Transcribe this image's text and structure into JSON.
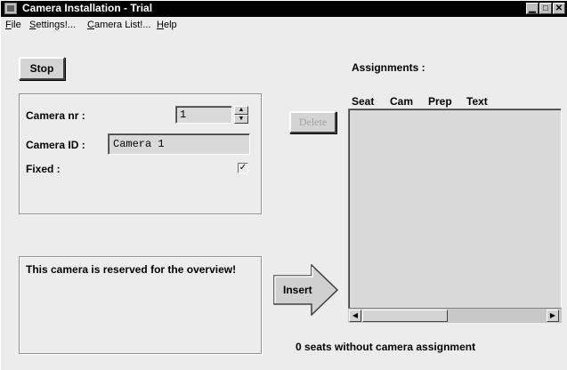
{
  "window": {
    "title": "Camera Installation - Trial",
    "minimize_glyph": "▁",
    "maximize_glyph": "□",
    "close_glyph": "✕"
  },
  "menu": {
    "file": "File",
    "settings": "Settings!...",
    "camera_list": "Camera List!...",
    "help": "Help"
  },
  "stop_label": "Stop",
  "camera": {
    "nr_label": "Camera nr :",
    "nr_value": "1",
    "spin_up_glyph": "▲",
    "spin_down_glyph": "▼",
    "id_label": "Camera ID :",
    "id_value": "Camera 1",
    "fixed_label": "Fixed :",
    "fixed_checked": true,
    "fixed_check_glyph": "✓"
  },
  "message": "This camera is reserved for the overview!",
  "insert_label": "Insert",
  "delete_label": "Delete",
  "assignments": {
    "title": "Assignments :",
    "columns": [
      "Seat",
      "Cam",
      "Prep",
      "Text"
    ],
    "rows": [],
    "scroll_left_glyph": "◀",
    "scroll_right_glyph": "▶"
  },
  "status": "0  seats without camera assignment",
  "colors": {
    "titlebar": "#000000",
    "window_bg": "#ececec",
    "list_bg": "#d9d9d9"
  },
  "icons": [
    "app-icon",
    "spin-up-icon",
    "spin-down-icon",
    "checkmark-icon",
    "right-arrow-icon",
    "scroll-left-icon",
    "scroll-right-icon"
  ]
}
